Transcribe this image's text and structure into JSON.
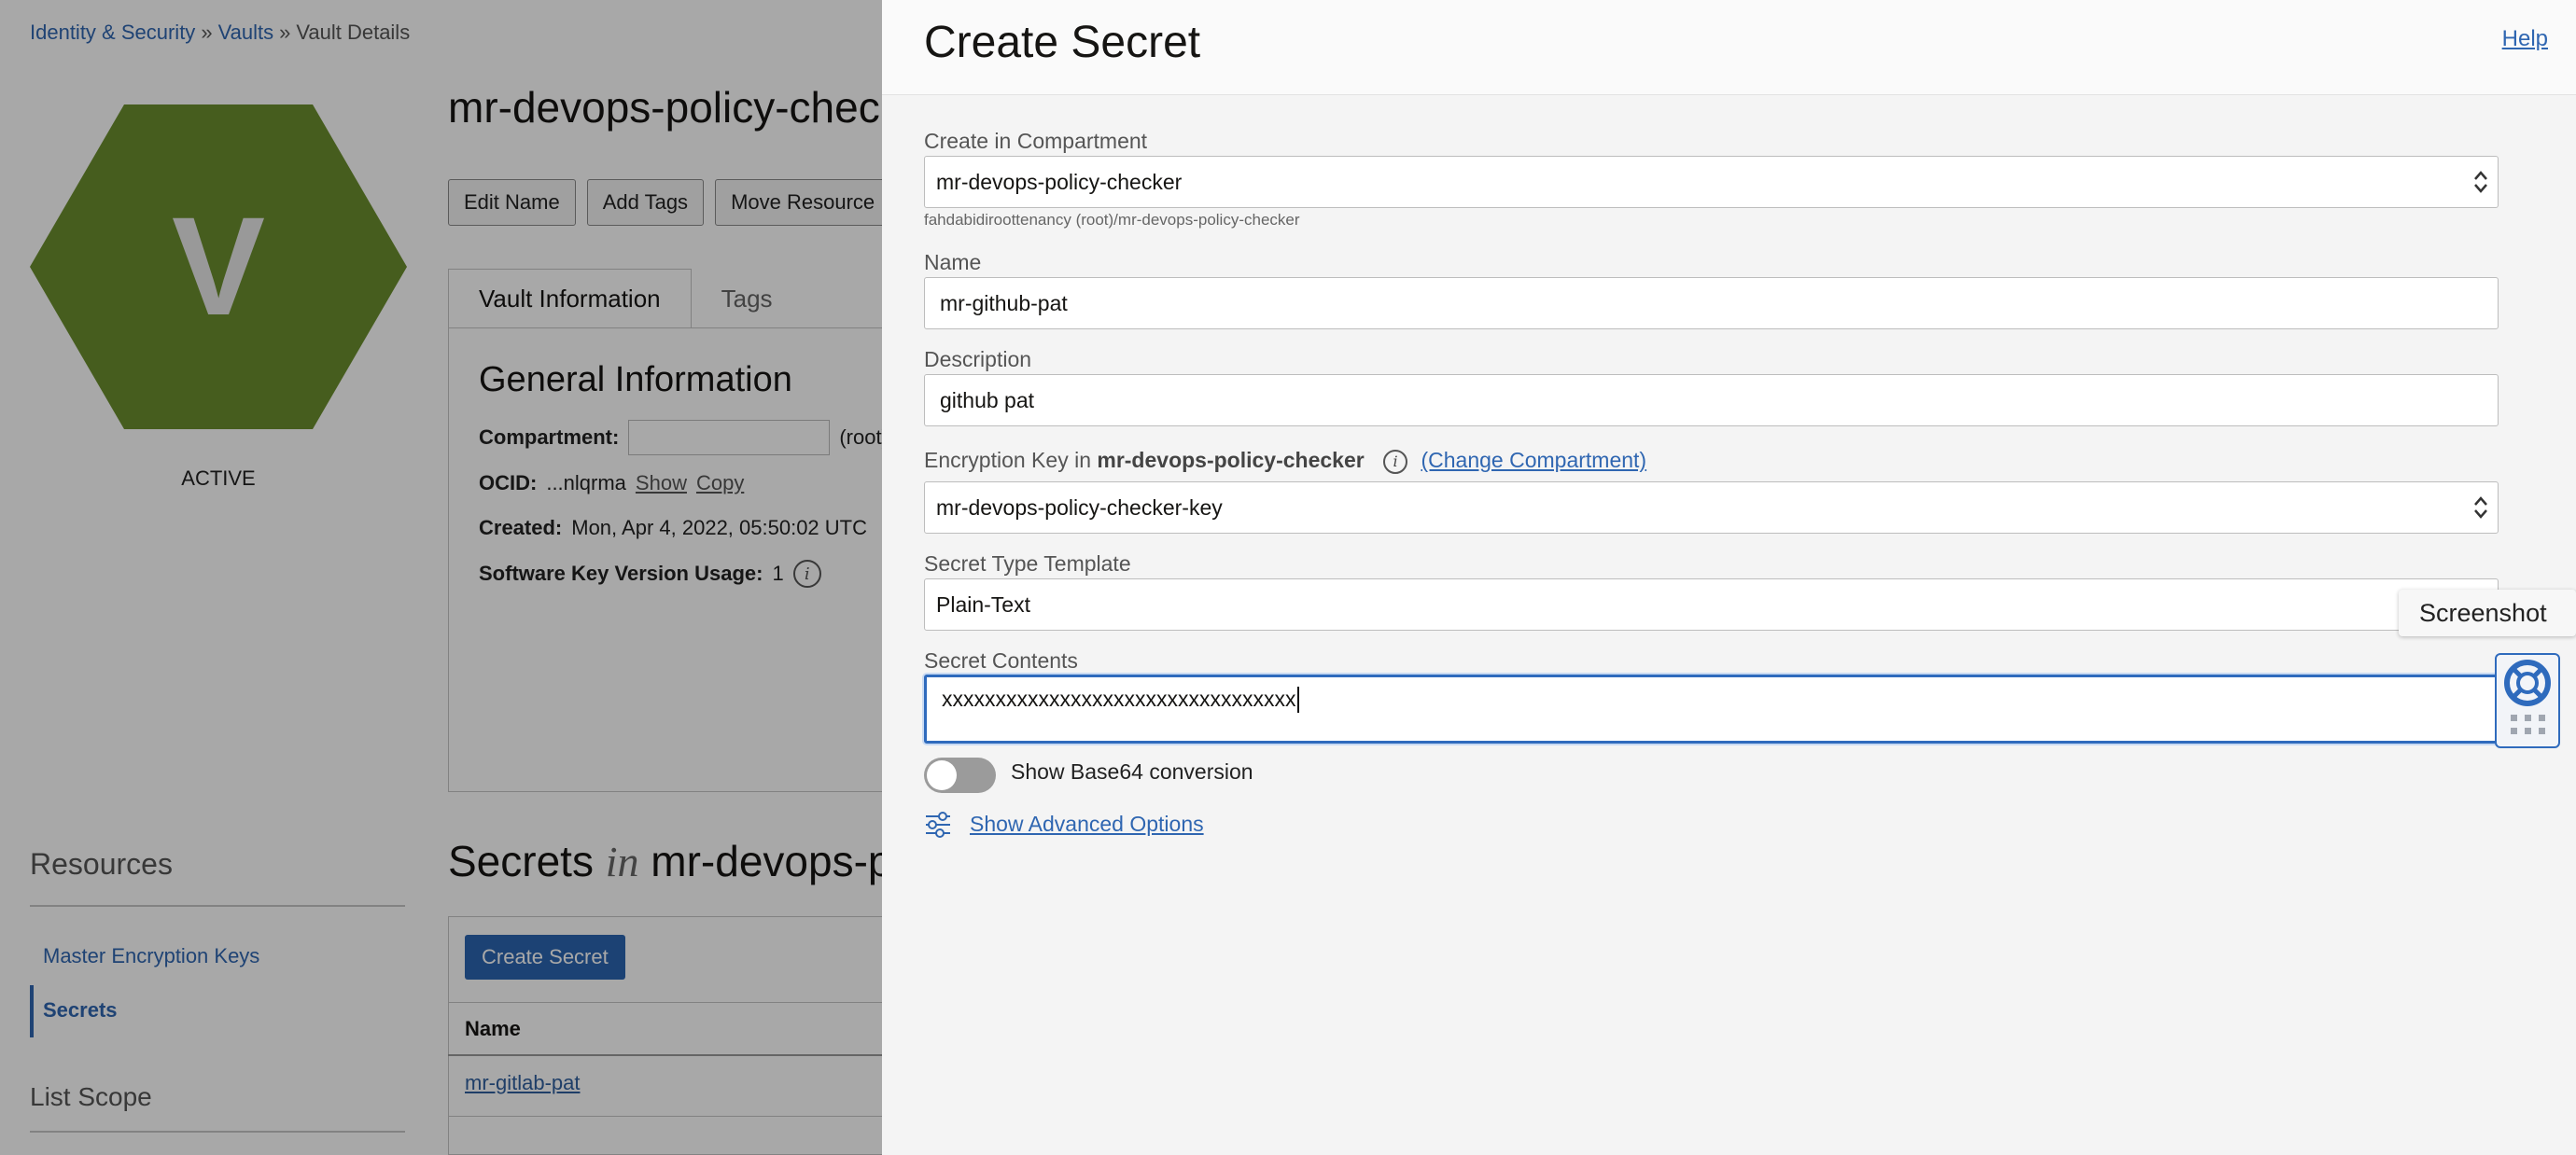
{
  "breadcrumb": {
    "items": [
      "Identity & Security",
      "Vaults"
    ],
    "current": "Vault Details",
    "separator": "»"
  },
  "vault": {
    "icon_letter": "V",
    "status": "ACTIVE",
    "title": "mr-devops-policy-chec",
    "buttons": [
      "Edit Name",
      "Add Tags",
      "Move Resource"
    ],
    "tabs": [
      "Vault Information",
      "Tags"
    ],
    "general_title": "General Information",
    "compartment_label": "Compartment:",
    "compartment_suffix": "(root)",
    "ocid_label": "OCID:",
    "ocid_value": "...nlqrma",
    "ocid_show": "Show",
    "ocid_copy": "Copy",
    "created_label": "Created:",
    "created_value": "Mon, Apr 4, 2022, 05:50:02 UTC",
    "skvu_label": "Software Key Version Usage:",
    "skvu_value": "1",
    "accent_color": "#6b8e2e"
  },
  "resources": {
    "title": "Resources",
    "items": [
      "Master Encryption Keys",
      "Secrets"
    ],
    "list_scope": "List Scope"
  },
  "secrets_list": {
    "title_prefix": "Secrets",
    "title_in": "in",
    "title_compartment": "mr-devops-p",
    "create_button": "Create Secret",
    "column_name": "Name",
    "rows": [
      "mr-gitlab-pat"
    ]
  },
  "drawer": {
    "title": "Create Secret",
    "help": "Help",
    "compartment_label": "Create in Compartment",
    "compartment_value": "mr-devops-policy-checker",
    "compartment_hint": "fahdabidiroottenancy (root)/mr-devops-policy-checker",
    "name_label": "Name",
    "name_value": "mr-github-pat",
    "description_label": "Description",
    "description_value": "github pat",
    "enc_key_label": "Encryption Key in",
    "enc_key_compartment": "mr-devops-policy-checker",
    "change_compartment": "(Change Compartment)",
    "enc_key_value": "mr-devops-policy-checker-key",
    "type_label": "Secret Type Template",
    "type_value": "Plain-Text",
    "contents_label": "Secret Contents",
    "contents_value": "xxxxxxxxxxxxxxxxxxxxxxxxxxxxxxxxx",
    "base64_label": "Show Base64 conversion",
    "base64_enabled": false,
    "advanced_link": "Show Advanced Options"
  },
  "floating": {
    "tooltip": "Screenshot"
  }
}
